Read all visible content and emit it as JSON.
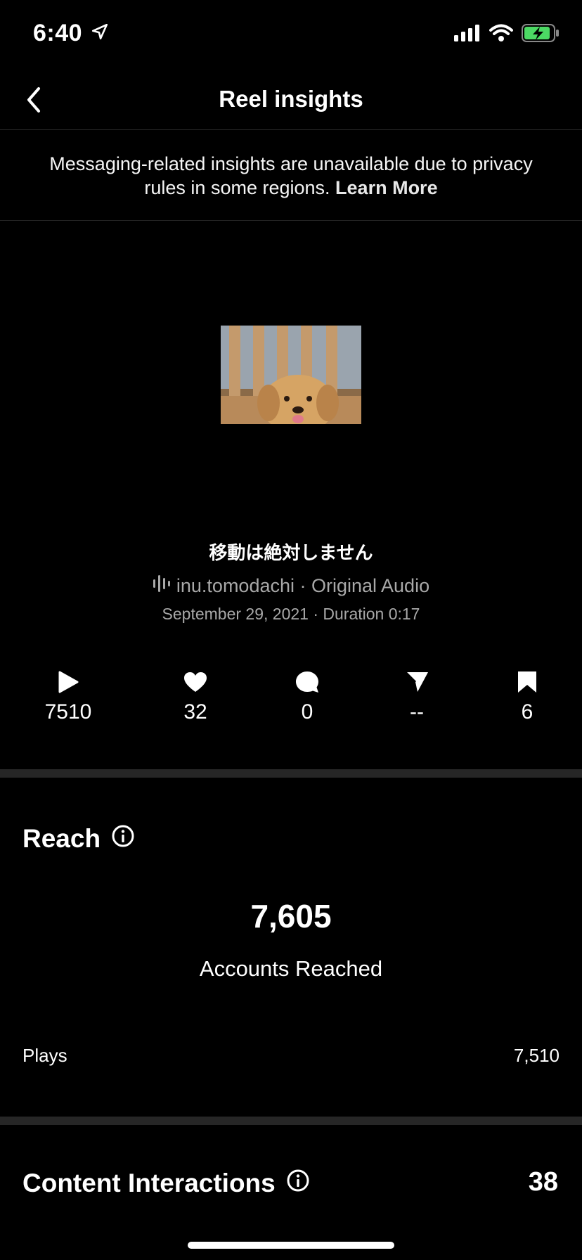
{
  "status": {
    "time": "6:40"
  },
  "nav": {
    "title": "Reel insights"
  },
  "notice": {
    "text": "Messaging-related insights are unavailable due to privacy rules in some regions.",
    "link": "Learn More"
  },
  "reel": {
    "caption": "移動は絶対しません",
    "audio": "inu.tomodachi · Original Audio",
    "meta": "September 29, 2021 · Duration 0:17"
  },
  "stats": {
    "plays": "7510",
    "likes": "32",
    "comments": "0",
    "shares": "--",
    "saves": "6"
  },
  "reach": {
    "title": "Reach",
    "value": "7,605",
    "label": "Accounts Reached",
    "plays_label": "Plays",
    "plays_value": "7,510"
  },
  "interactions": {
    "title": "Content Interactions",
    "value": "38"
  },
  "colors": {
    "background": "#000000",
    "text": "#ffffff",
    "muted": "#a8a8a8",
    "divider": "#262626",
    "battery": "#4cd964"
  }
}
